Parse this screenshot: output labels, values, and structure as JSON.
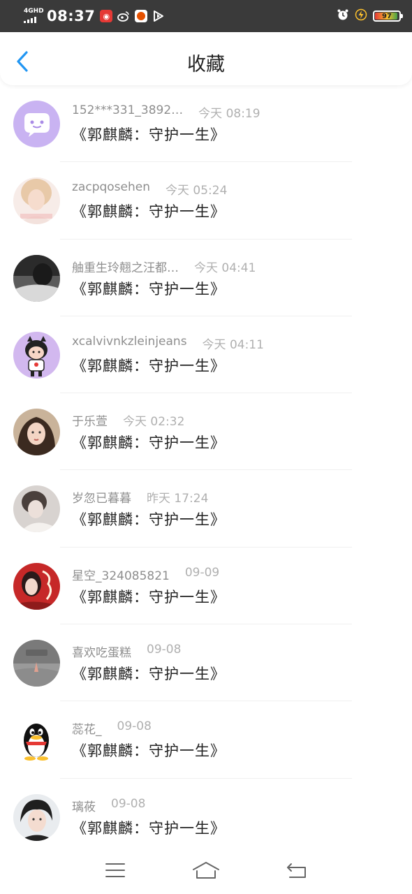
{
  "status_bar": {
    "network": "4GHD",
    "time": "08:37",
    "battery": "97"
  },
  "header": {
    "title": "收藏"
  },
  "items": [
    {
      "name": "152***331_3892…",
      "time": "今天 08:19",
      "title": "《郭麒麟：守护一生》"
    },
    {
      "name": "zacpqosehen",
      "time": "今天 05:24",
      "title": "《郭麒麟：守护一生》"
    },
    {
      "name": "舳重生玲翹之汪都…",
      "time": "今天 04:41",
      "title": "《郭麒麟：守护一生》"
    },
    {
      "name": "xcalvivnkzleinjeans",
      "time": "今天 04:11",
      "title": "《郭麒麟：守护一生》"
    },
    {
      "name": "于乐萱",
      "time": "今天 02:32",
      "title": "《郭麒麟：守护一生》"
    },
    {
      "name": "岁忽已暮暮",
      "time": "昨天 17:24",
      "title": "《郭麒麟：守护一生》"
    },
    {
      "name": "星空_324085821",
      "time": "09-09",
      "title": "《郭麒麟：守护一生》"
    },
    {
      "name": "喜欢吃蛋糕",
      "time": "09-08",
      "title": "《郭麒麟：守护一生》"
    },
    {
      "name": "蕊花_",
      "time": "09-08",
      "title": "《郭麒麟：守护一生》"
    },
    {
      "name": "璃莜",
      "time": "09-08",
      "title": "《郭麒麟：守护一生》"
    }
  ],
  "colors": {
    "accent": "#2196f3",
    "status_bar_bg": "#3a3a3a"
  }
}
